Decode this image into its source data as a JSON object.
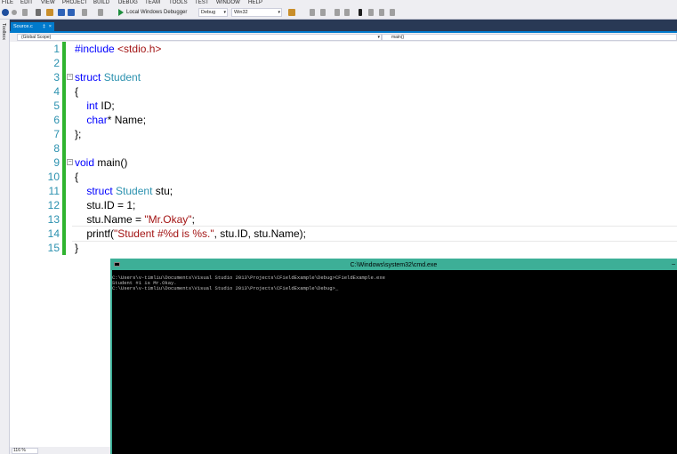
{
  "menu": [
    "FILE",
    "EDIT",
    "VIEW",
    "PROJECT",
    "BUILD",
    "DEBUG",
    "TEAM",
    "TOOLS",
    "TEST",
    "WINDOW",
    "HELP"
  ],
  "toolbar": {
    "start_label": "Local Windows Debugger",
    "config": "Debug",
    "platform": "Win32"
  },
  "toolbox_label": "Toolbox",
  "tab": {
    "name": "Source.c",
    "pin": "‡",
    "close": "×"
  },
  "nav": {
    "scope": "(Global Scope)",
    "member": "main()"
  },
  "code_lines": [
    {
      "num": "1",
      "html": "<span class=\"kw\">#include</span> <span class=\"st\">&lt;stdio.h&gt;</span>"
    },
    {
      "num": "2",
      "html": ""
    },
    {
      "num": "3",
      "fold": "−",
      "html": "<span class=\"kw\">struct</span> <span class=\"ty\">Student</span>"
    },
    {
      "num": "4",
      "html": "{"
    },
    {
      "num": "5",
      "html": "    <span class=\"kw\">int</span> ID;"
    },
    {
      "num": "6",
      "html": "    <span class=\"kw\">char</span>* Name;"
    },
    {
      "num": "7",
      "html": "};"
    },
    {
      "num": "8",
      "html": ""
    },
    {
      "num": "9",
      "fold": "−",
      "html": "<span class=\"kw\">void</span> main()"
    },
    {
      "num": "10",
      "html": "{"
    },
    {
      "num": "11",
      "html": "    <span class=\"kw\">struct</span> <span class=\"ty\">Student</span> stu;"
    },
    {
      "num": "12",
      "html": "    stu.ID = 1;"
    },
    {
      "num": "13",
      "html": "    stu.Name = <span class=\"st\">\"Mr.Okay\"</span>;"
    },
    {
      "num": "14",
      "html": "    printf(<span class=\"st\">\"Student #%d is %s.\"</span>, stu.ID, stu.Name);",
      "current": true
    },
    {
      "num": "15",
      "html": "}"
    }
  ],
  "zoom": "116 %",
  "cmd": {
    "title": "C:\\Windows\\system32\\cmd.exe",
    "close": "–",
    "lines": [
      "C:\\Users\\v-timliu\\Documents\\Visual Studio 2013\\Projects\\CFieldExample\\Debug>CFieldExample.exe",
      "Student #1 is Mr.Okay.",
      "C:\\Users\\v-timliu\\Documents\\Visual Studio 2013\\Projects\\CFieldExample\\Debug>_"
    ]
  }
}
